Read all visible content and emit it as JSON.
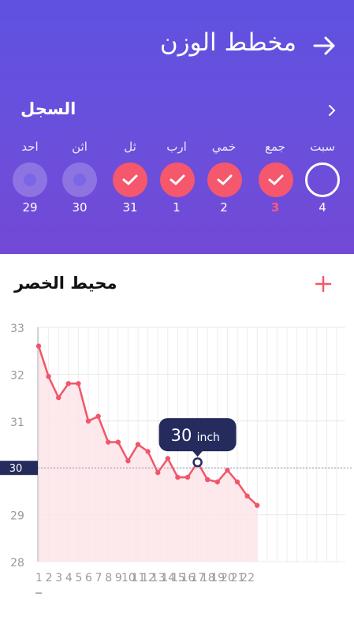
{
  "header": {
    "title": "مخطط الوزن",
    "record_label": "السجل"
  },
  "days": [
    {
      "name": "احد",
      "date": "29",
      "state": "light"
    },
    {
      "name": "اثن",
      "date": "30",
      "state": "light"
    },
    {
      "name": "ثل",
      "date": "31",
      "state": "checked"
    },
    {
      "name": "ارب",
      "date": "1",
      "state": "checked"
    },
    {
      "name": "خمي",
      "date": "2",
      "state": "checked"
    },
    {
      "name": "جمع",
      "date": "3",
      "state": "checked",
      "today": true
    },
    {
      "name": "سبت",
      "date": "4",
      "state": "open"
    }
  ],
  "section": {
    "title": "محيط الخصر"
  },
  "tooltip": {
    "value": "30",
    "unit": "inch"
  },
  "colors": {
    "accent": "#f5576c",
    "header_top": "#5f52e0",
    "header_bottom": "#7249d6",
    "tooltip_bg": "#262b5e"
  },
  "chart_data": {
    "type": "line",
    "x": [
      1,
      2,
      3,
      4,
      5,
      6,
      7,
      8,
      9,
      10,
      11,
      12,
      13,
      14,
      15,
      16,
      17,
      18,
      19,
      20,
      21,
      22
    ],
    "x_tick_labels": [
      "1",
      "2",
      "3",
      "4",
      "5",
      "6",
      "7",
      "8",
      "9",
      "10",
      "11",
      "12",
      "13",
      "14",
      "15",
      "16",
      "17",
      "18",
      "19",
      "20",
      "21",
      "22"
    ],
    "points": [
      [
        1,
        32.6
      ],
      [
        2,
        31.95
      ],
      [
        3,
        31.5
      ],
      [
        4,
        31.8
      ],
      [
        5,
        31.8
      ],
      [
        6,
        31.0
      ],
      [
        7,
        31.1
      ],
      [
        8,
        30.55
      ],
      [
        9,
        30.55
      ],
      [
        10,
        30.15
      ],
      [
        11,
        30.5
      ],
      [
        12,
        30.35
      ],
      [
        13,
        29.9
      ],
      [
        14,
        30.2
      ],
      [
        15,
        29.8
      ],
      [
        16,
        29.8
      ],
      [
        17,
        30.12
      ],
      [
        18,
        29.75
      ],
      [
        19,
        29.7
      ],
      [
        20,
        29.95
      ],
      [
        21,
        29.7
      ],
      [
        22,
        29.4
      ],
      [
        23,
        29.2
      ]
    ],
    "y_ticks": [
      28,
      29,
      30,
      31,
      32,
      33
    ],
    "ylim": [
      28,
      33
    ],
    "target": 30,
    "target_label": "30",
    "highlight_x": 17,
    "grid": true
  }
}
